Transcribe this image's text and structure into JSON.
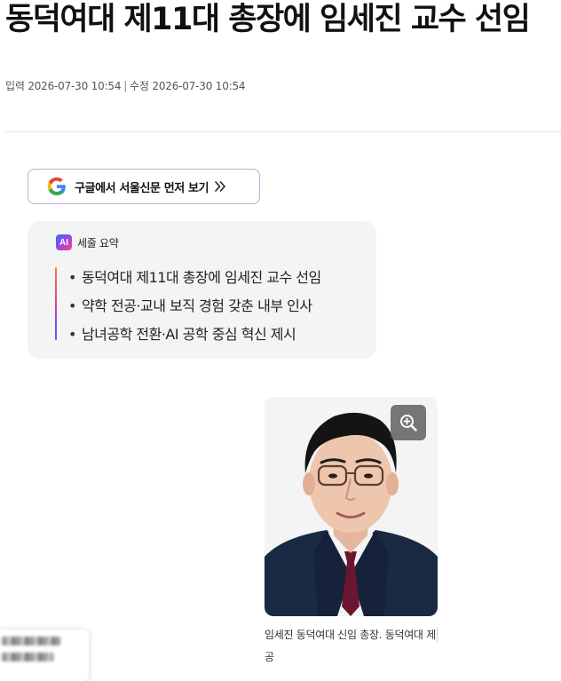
{
  "article": {
    "headline": "동덕여대 제11대 총장에 임세진 교수 선임",
    "byline": {
      "published_label": "입력",
      "published_value": "2026-07-30 10:54",
      "separator": "|",
      "modified_label": "수정",
      "modified_value": "2026-07-30 10:54"
    }
  },
  "google_cta": {
    "label": "구글에서 서울신문 먼저 보기",
    "icon": "google-g-icon",
    "chevron_icon": "double-chevron-right-icon",
    "border_color": "#caa8d8"
  },
  "ai_summary": {
    "badge": "AI",
    "title": "세줄 요약",
    "items": [
      "동덕여대 제11대 총장에 임세진 교수 선임",
      "약학 전공·교내 보직 경험 갖춘 내부 인사",
      "남녀공학 전환·AI 공학 중심 혁신 제시"
    ],
    "accent_gradient": [
      "#ff7a2f",
      "#e0448f",
      "#7a4df0",
      "#3c6df5"
    ]
  },
  "photo": {
    "zoom_icon": "zoom-in-icon",
    "caption": "임세진 동덕여대 신임 총장. 동덕여대 제공"
  },
  "floating_card": {
    "state": "blurred"
  }
}
